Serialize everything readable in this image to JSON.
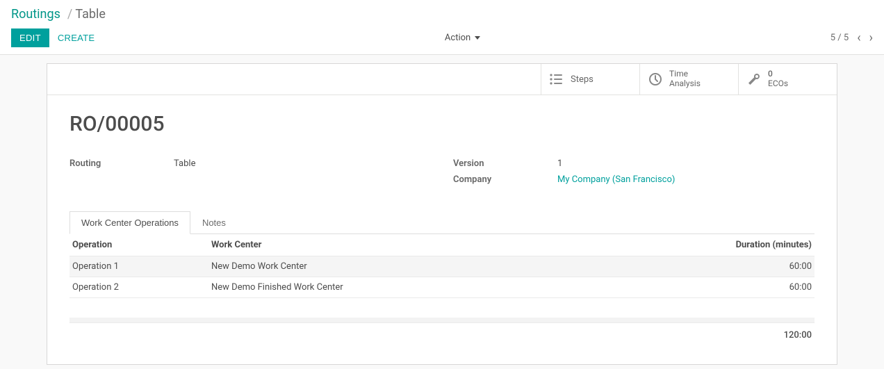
{
  "breadcrumb": {
    "root": "Routings",
    "current": "Table"
  },
  "toolbar": {
    "edit": "EDIT",
    "create": "CREATE",
    "action": "Action"
  },
  "pager": {
    "position": "5 / 5"
  },
  "buttonBox": {
    "steps": "Steps",
    "time1": "Time",
    "time2": "Analysis",
    "ecos_count": "0",
    "ecos_label": "ECOs"
  },
  "record": {
    "title": "RO/00005",
    "fields_left": [
      {
        "label": "Routing",
        "value": "Table"
      }
    ],
    "fields_right": [
      {
        "label": "Version",
        "value": "1"
      },
      {
        "label": "Company",
        "value": "My Company (San Francisco)",
        "link": true
      }
    ]
  },
  "tabs": [
    {
      "label": "Work Center Operations",
      "active": true
    },
    {
      "label": "Notes",
      "active": false
    }
  ],
  "operations": {
    "columns": {
      "op": "Operation",
      "wc": "Work Center",
      "dur": "Duration (minutes)"
    },
    "rows": [
      {
        "op": "Operation 1",
        "wc": "New Demo Work Center",
        "dur": "60:00"
      },
      {
        "op": "Operation 2",
        "wc": "New Demo Finished Work Center",
        "dur": "60:00"
      }
    ],
    "total": "120:00"
  }
}
